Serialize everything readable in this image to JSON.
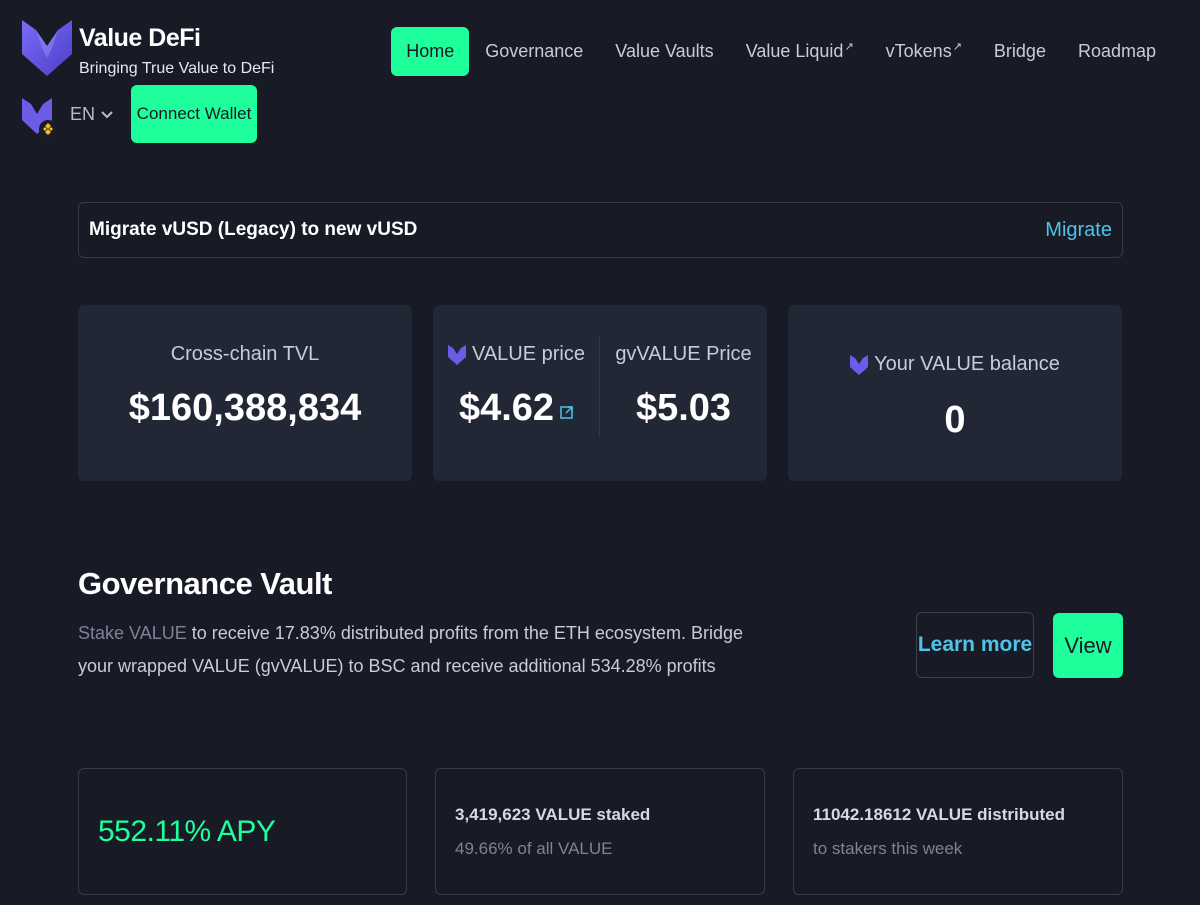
{
  "brand": {
    "title": "Value DeFi",
    "subtitle": "Bringing True Value to DeFi"
  },
  "nav": {
    "items": [
      {
        "label": "Home",
        "active": true,
        "external": false
      },
      {
        "label": "Governance",
        "active": false,
        "external": false
      },
      {
        "label": "Value Vaults",
        "active": false,
        "external": false
      },
      {
        "label": "Value Liquid",
        "active": false,
        "external": true
      },
      {
        "label": "vTokens",
        "active": false,
        "external": true
      },
      {
        "label": "Bridge",
        "active": false,
        "external": false
      },
      {
        "label": "Roadmap",
        "active": false,
        "external": false
      }
    ],
    "external_mark": "↗"
  },
  "language": {
    "selected": "EN"
  },
  "connect_wallet": {
    "label": "Connect Wallet"
  },
  "banner": {
    "text": "Migrate vUSD (Legacy) to new vUSD",
    "link": "Migrate"
  },
  "stats": {
    "tvl": {
      "label": "Cross-chain TVL",
      "value": "$160,388,834"
    },
    "value_price": {
      "label": "VALUE price",
      "value": "$4.62"
    },
    "gvvalue_price": {
      "label": "gvVALUE Price",
      "value": "$5.03"
    },
    "balance": {
      "label": "Your VALUE balance",
      "value": "0"
    }
  },
  "governance": {
    "title": "Governance Vault",
    "desc_lead": "Stake VALUE",
    "desc_rest": " to receive 17.83% distributed profits from the ETH ecosystem. Bridge your wrapped VALUE (gvVALUE) to BSC and receive additional 534.28% profits",
    "learn_more": "Learn more",
    "view": "View"
  },
  "info": {
    "apy": "552.11% APY",
    "staked_main": "3,419,623 VALUE staked",
    "staked_sub": "49.66% of all VALUE",
    "distributed_main": "11042.18612 VALUE distributed",
    "distributed_sub": "to stakers this week"
  },
  "colors": {
    "background": "#181b26",
    "card": "#222736",
    "accent_green": "#1eff9c",
    "link_blue": "#4fc3e8",
    "logo_purple": "#6c5ce7"
  },
  "icons": {
    "logo": "value-defi-logo-icon",
    "chain": "bsc-chain-icon",
    "dropdown": "chevron-down-icon",
    "external": "external-link-icon"
  }
}
